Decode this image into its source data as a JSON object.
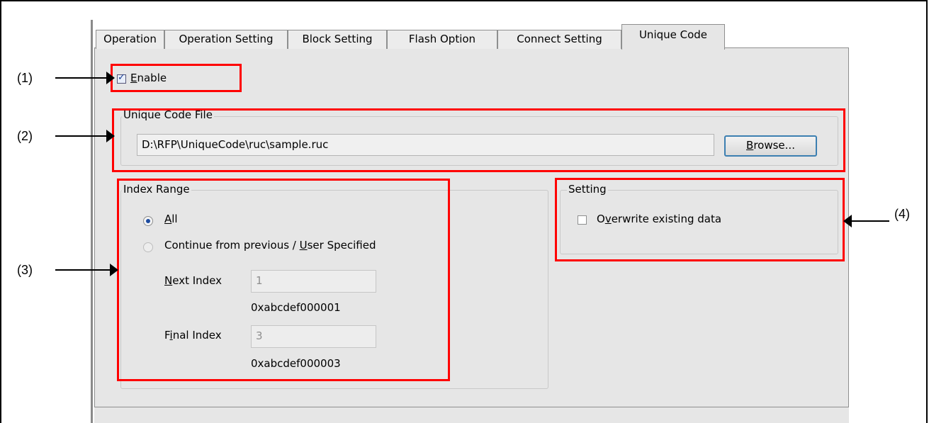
{
  "tabs": [
    {
      "label": "Operation",
      "active": false
    },
    {
      "label": "Operation Setting",
      "active": false
    },
    {
      "label": "Block Setting",
      "active": false
    },
    {
      "label": "Flash Option",
      "active": false
    },
    {
      "label": "Connect Setting",
      "active": false
    },
    {
      "label": "Unique Code",
      "active": true
    }
  ],
  "enable": {
    "label_underlined": "E",
    "label_rest": "nable",
    "checked": true
  },
  "unique_code_file": {
    "group_title": "Unique Code File",
    "path": "D:\\RFP\\UniqueCode\\ruc\\sample.ruc",
    "browse_underlined": "B",
    "browse_rest": "rowse..."
  },
  "index_range": {
    "group_title": "Index Range",
    "all_underlined": "A",
    "all_rest": "ll",
    "continue_prefix": "Continue from previous / ",
    "continue_underlined": "U",
    "continue_rest": "ser Specified",
    "selected": "All",
    "next_index_underlined": "N",
    "next_index_rest": "ext Index",
    "next_index_value": "1",
    "next_index_hex": "0xabcdef000001",
    "final_index_prefix": "F",
    "final_index_underlined": "i",
    "final_index_rest": "nal Index",
    "final_index_value": "3",
    "final_index_hex": "0xabcdef000003"
  },
  "setting": {
    "group_title": "Setting",
    "overwrite_prefix": "O",
    "overwrite_underlined": "v",
    "overwrite_rest": "erwrite existing data",
    "overwrite_checked": false
  },
  "callouts": {
    "c1": "(1)",
    "c2": "(2)",
    "c3": "(3)",
    "c4": "(4)"
  },
  "colors": {
    "highlight": "#ff0000",
    "panel": "#e6e6e6"
  }
}
